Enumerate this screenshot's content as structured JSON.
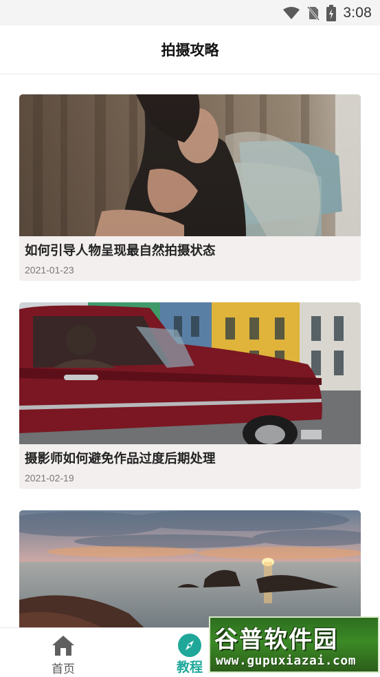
{
  "status_bar": {
    "time": "3:08",
    "icons": [
      "wifi-icon",
      "no-sim-icon",
      "battery-charging-icon"
    ]
  },
  "header": {
    "title": "拍摄攻略"
  },
  "articles": [
    {
      "title": "如何引导人物呈现最自然拍摄状态",
      "date": "2021-01-23",
      "image": "portrait-photo"
    },
    {
      "title": "摄影师如何避免作品过度后期处理",
      "date": "2021-02-19",
      "image": "red-vintage-car-photo"
    },
    {
      "title": "",
      "date": "",
      "image": "sunset-seascape-photo"
    }
  ],
  "bottom_nav": {
    "items": [
      {
        "label": "首页",
        "icon": "home-icon",
        "active": false
      },
      {
        "label": "教程",
        "icon": "compass-icon",
        "active": true
      }
    ],
    "active_color": "#1fa89a"
  },
  "watermark": {
    "logo_text": "谷普软件园",
    "url": "www.gupuxiazai.com"
  }
}
